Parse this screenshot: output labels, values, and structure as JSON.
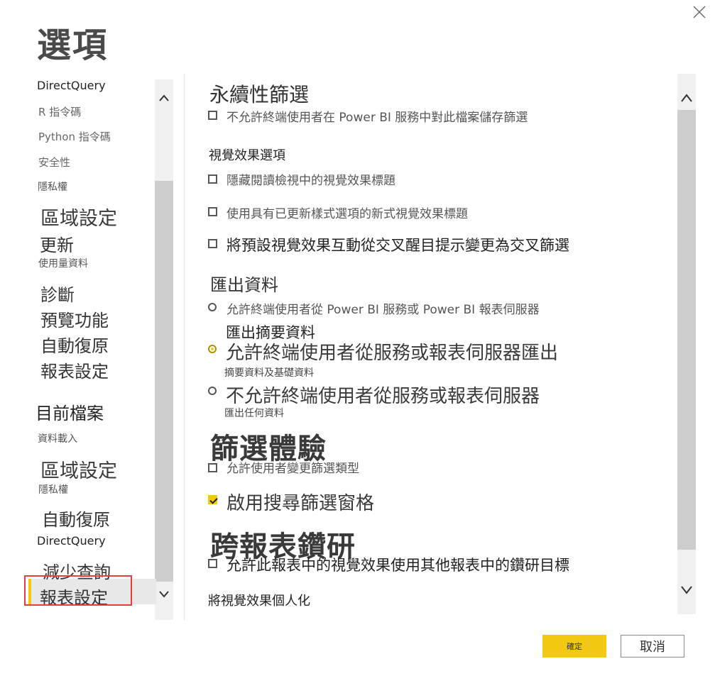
{
  "dialog": {
    "title": "選項",
    "close_icon": "close-icon"
  },
  "left_nav": {
    "items": [
      {
        "label": "DirectQuery"
      },
      {
        "label": "R 指令碼"
      },
      {
        "label": "Python 指令碼"
      },
      {
        "label": "安全性"
      },
      {
        "label": "隱私權"
      },
      {
        "label": "區域設定"
      },
      {
        "label": "更新"
      },
      {
        "label": "使用量資料"
      },
      {
        "label": "診斷"
      },
      {
        "label": "預覽功能"
      },
      {
        "label": "自動復原"
      },
      {
        "label": "報表設定"
      }
    ],
    "current_file_header": "目前檔案",
    "current_file_items": [
      {
        "label": "資料載入"
      },
      {
        "label": "區域設定"
      },
      {
        "label": "隱私權"
      },
      {
        "label": "自動復原"
      },
      {
        "label": "DirectQuery"
      },
      {
        "label": "減少查詢"
      },
      {
        "label": "報表設定"
      }
    ],
    "scroll_up_icon": "chevron-up-icon",
    "scroll_down_icon": "chevron-down-icon"
  },
  "content": {
    "persistent_filters": {
      "heading": "永續性篩選",
      "option": "不允許終端使用者在 Power BI 服務中對此檔案儲存篩選",
      "checked": false
    },
    "visual_options": {
      "heading": "視覺效果選項",
      "options": [
        {
          "label": "隱藏閱讀檢視中的視覺效果標題",
          "checked": false
        },
        {
          "label": "使用具有已更新樣式選項的新式視覺效果標題",
          "checked": false
        },
        {
          "label": "將預設視覺效果互動從交叉醒目提示變更為交叉篩選",
          "checked": false
        }
      ]
    },
    "export_data": {
      "heading": "匯出資料",
      "options": [
        {
          "label": "允許終端使用者從 Power BI 服務或 Power BI 報表伺服器",
          "sub": "匯出摘要資料",
          "selected": false
        },
        {
          "label": "允許終端使用者從服務或報表伺服器匯出",
          "sub": "摘要資料及基礎資料",
          "selected": true
        },
        {
          "label": "不允許終端使用者從服務或報表伺服器",
          "sub": "匯出任何資料",
          "selected": false
        }
      ]
    },
    "filtering_experience": {
      "heading": "篩選體驗",
      "options": [
        {
          "label": "允許使用者變更篩選類型",
          "checked": false
        },
        {
          "label": "啟用搜尋篩選窗格",
          "checked": true
        }
      ]
    },
    "cross_report_drillthrough": {
      "heading": "跨報表鑽研",
      "option": "允許此報表中的視覺效果使用其他報表中的鑽研目標",
      "checked": false
    },
    "personalize_visuals": {
      "heading": "將視覺效果個人化"
    },
    "scroll_up_icon": "chevron-up-icon",
    "scroll_down_icon": "chevron-down-icon"
  },
  "footer": {
    "ok_label": "確定",
    "cancel_label": "取消"
  },
  "colors": {
    "accent": "#f2c811",
    "selection_outline": "#e04040"
  }
}
